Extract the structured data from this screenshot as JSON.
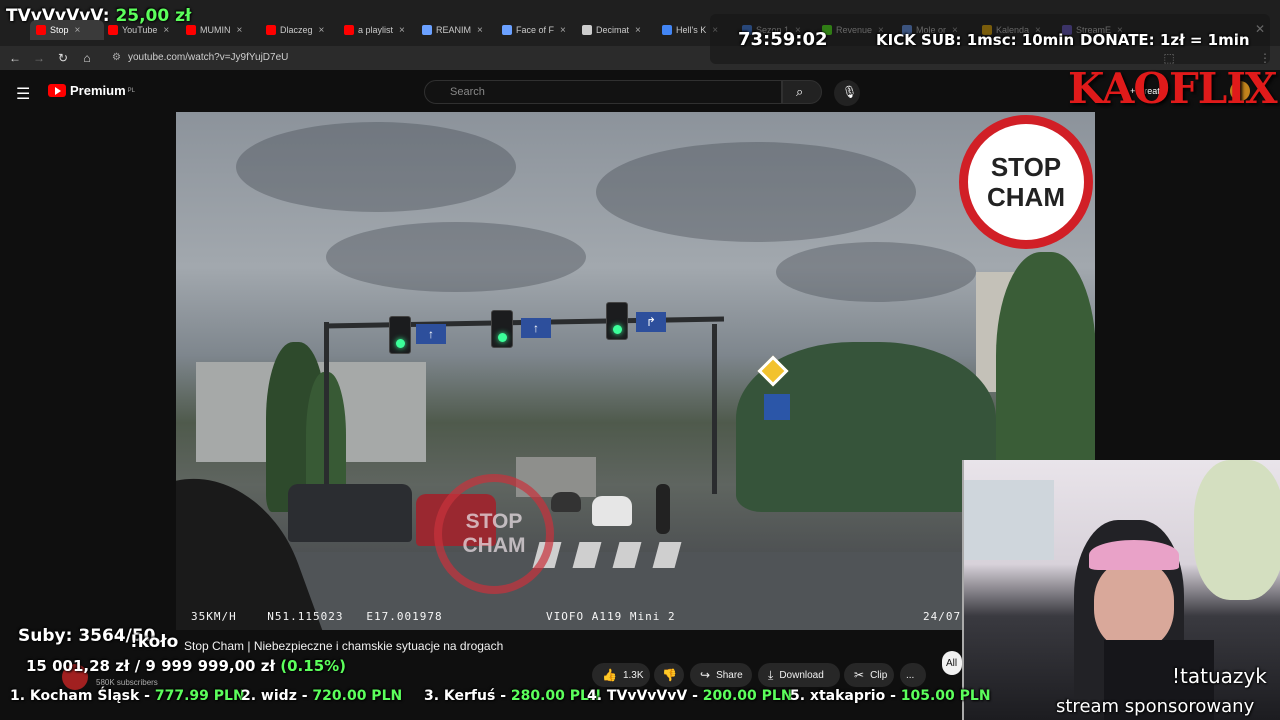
{
  "overlay": {
    "tvv_name": "TVvVvVvV:",
    "tvv_amount": "25,00 zł",
    "timer": "73:59:02",
    "kick_sub": "KICK SUB: 1msc: 10min",
    "donate": "DONATE: 1zł = 1min",
    "brand": "KAOFLIX",
    "subs_count": "Suby: 3564/50",
    "goal_text": "15 001,28 zł / 9 999 999,00 zł",
    "goal_percent": "(0.15%)",
    "kolo": "!koło",
    "tatuazyk": "!tatuazyk",
    "sponsored": "stream sponsorowany",
    "ticker": [
      {
        "rank": "1. Kocham Śląsk - ",
        "amount": "777.99 PLN"
      },
      {
        "rank": "2. widz - ",
        "amount": "720.00 PLN"
      },
      {
        "rank": "3. Kerfuś - ",
        "amount": "280.00 PLN"
      },
      {
        "rank": "4. TVvVvVvV - ",
        "amount": "200.00 PLN"
      },
      {
        "rank": "5. xtakaprio - ",
        "amount": "105.00 PLN"
      }
    ]
  },
  "browser": {
    "tabs": [
      {
        "label": "Stop",
        "color": "#ff0000",
        "active": true
      },
      {
        "label": "YouTube",
        "color": "#ff0000"
      },
      {
        "label": "MUMIN",
        "color": "#ff0000"
      },
      {
        "label": "Dlaczeg",
        "color": "#ff0000"
      },
      {
        "label": "a playlist",
        "color": "#ff0000"
      },
      {
        "label": "REANIM",
        "color": "#6aa0ff"
      },
      {
        "label": "Face of F",
        "color": "#6aa0ff"
      },
      {
        "label": "Decimat",
        "color": "#cccccc"
      },
      {
        "label": "Hell's K",
        "color": "#4285f4"
      },
      {
        "label": "Sezon 1",
        "color": "#4285f4"
      },
      {
        "label": "Revenue",
        "color": "#53fc18"
      },
      {
        "label": "Mole or",
        "color": "#6aa0ff"
      },
      {
        "label": "Kalenda",
        "color": "#f4b400"
      },
      {
        "label": "StreamE",
        "color": "#6a5acd"
      }
    ],
    "url": "youtube.com/watch?v=Jy9fYujD7eU"
  },
  "youtube": {
    "logo": "Premium",
    "logo_sup": "PL",
    "search_placeholder": "Search",
    "create": "Create",
    "video_title": "Stop Cham | Niebezpieczne i chamskie sytuacje na drogach",
    "channel_subs": "580K subscribers",
    "likes": "1.3K",
    "share": "Share",
    "download": "Download",
    "clip": "Clip",
    "more": "...",
    "all_chip": "All"
  },
  "video": {
    "stop_line1": "STOP",
    "stop_line2": "CHAM",
    "osd_speed": "35KM/H",
    "osd_lat": "N51.115023",
    "osd_lon": "E17.001978",
    "osd_cam": "VIOFO A119 Mini 2",
    "osd_date": "24/07"
  }
}
